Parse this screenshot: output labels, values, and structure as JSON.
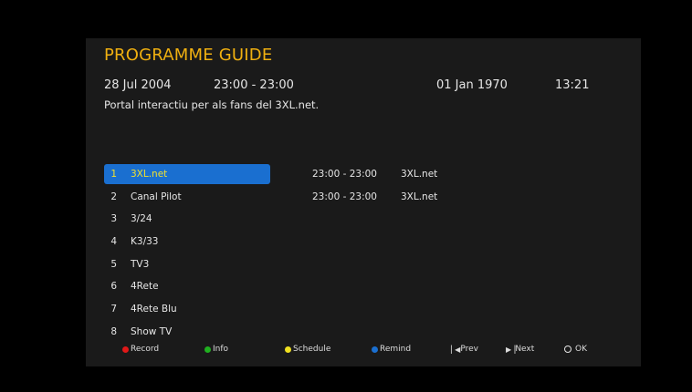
{
  "header": {
    "title": "PROGRAMME GUIDE",
    "event_date": "28 Jul 2004",
    "event_time": "23:00 - 23:00",
    "current_date": "01 Jan 1970",
    "current_time": "13:21",
    "description": "Portal interactiu per als fans del 3XL.net."
  },
  "channels": [
    {
      "num": "1",
      "name": "3XL.net",
      "selected": true
    },
    {
      "num": "2",
      "name": "Canal Pilot"
    },
    {
      "num": "3",
      "name": "3/24"
    },
    {
      "num": "4",
      "name": "K3/33"
    },
    {
      "num": "5",
      "name": "TV3"
    },
    {
      "num": "6",
      "name": "4Rete"
    },
    {
      "num": "7",
      "name": "4Rete Blu"
    },
    {
      "num": "8",
      "name": "Show TV"
    }
  ],
  "events": [
    {
      "time": "23:00 - 23:00",
      "title": "3XL.net"
    },
    {
      "time": "23:00 - 23:00",
      "title": "3XL.net"
    }
  ],
  "footer": {
    "record": {
      "label": "Record",
      "color": "#e01818"
    },
    "info": {
      "label": "Info",
      "color": "#20b020"
    },
    "schedule": {
      "label": "Schedule",
      "color": "#f0e020"
    },
    "remind": {
      "label": "Remind",
      "color": "#1a6fd0"
    },
    "prev": {
      "label": "Prev",
      "icon": "skip-previous-icon"
    },
    "next": {
      "label": "Next",
      "icon": "skip-next-icon"
    },
    "ok": {
      "label": "OK",
      "icon": "ok-ring-icon"
    }
  },
  "colors": {
    "accent_title": "#f0b010",
    "selection": "#1a6fd0",
    "selected_text": "#f0e030"
  }
}
